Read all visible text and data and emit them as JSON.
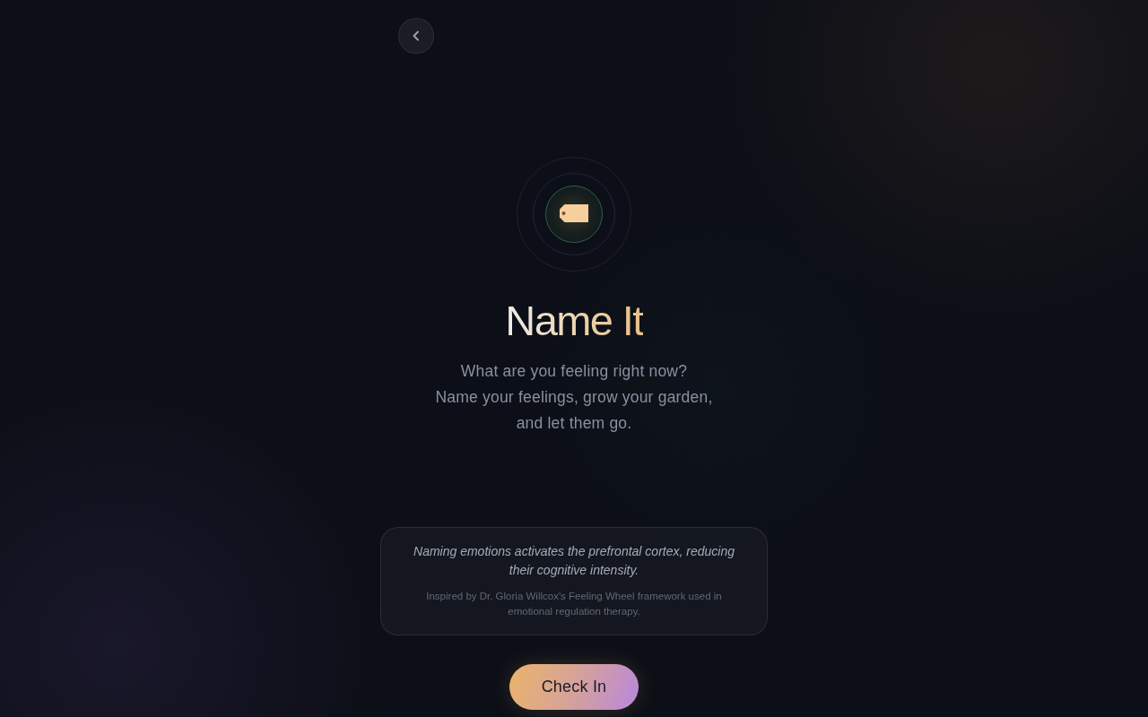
{
  "title": "Name It",
  "subtitle": "What are you feeling right now?\nName your feelings, grow your garden,\nand let them go.",
  "info_card": {
    "fact": "Naming emotions activates the prefrontal cortex, reducing their cognitive intensity.",
    "source": "Inspired by Dr. Gloria Willcox's Feeling Wheel framework used in emotional regulation therapy."
  },
  "primary_button": "Check In"
}
